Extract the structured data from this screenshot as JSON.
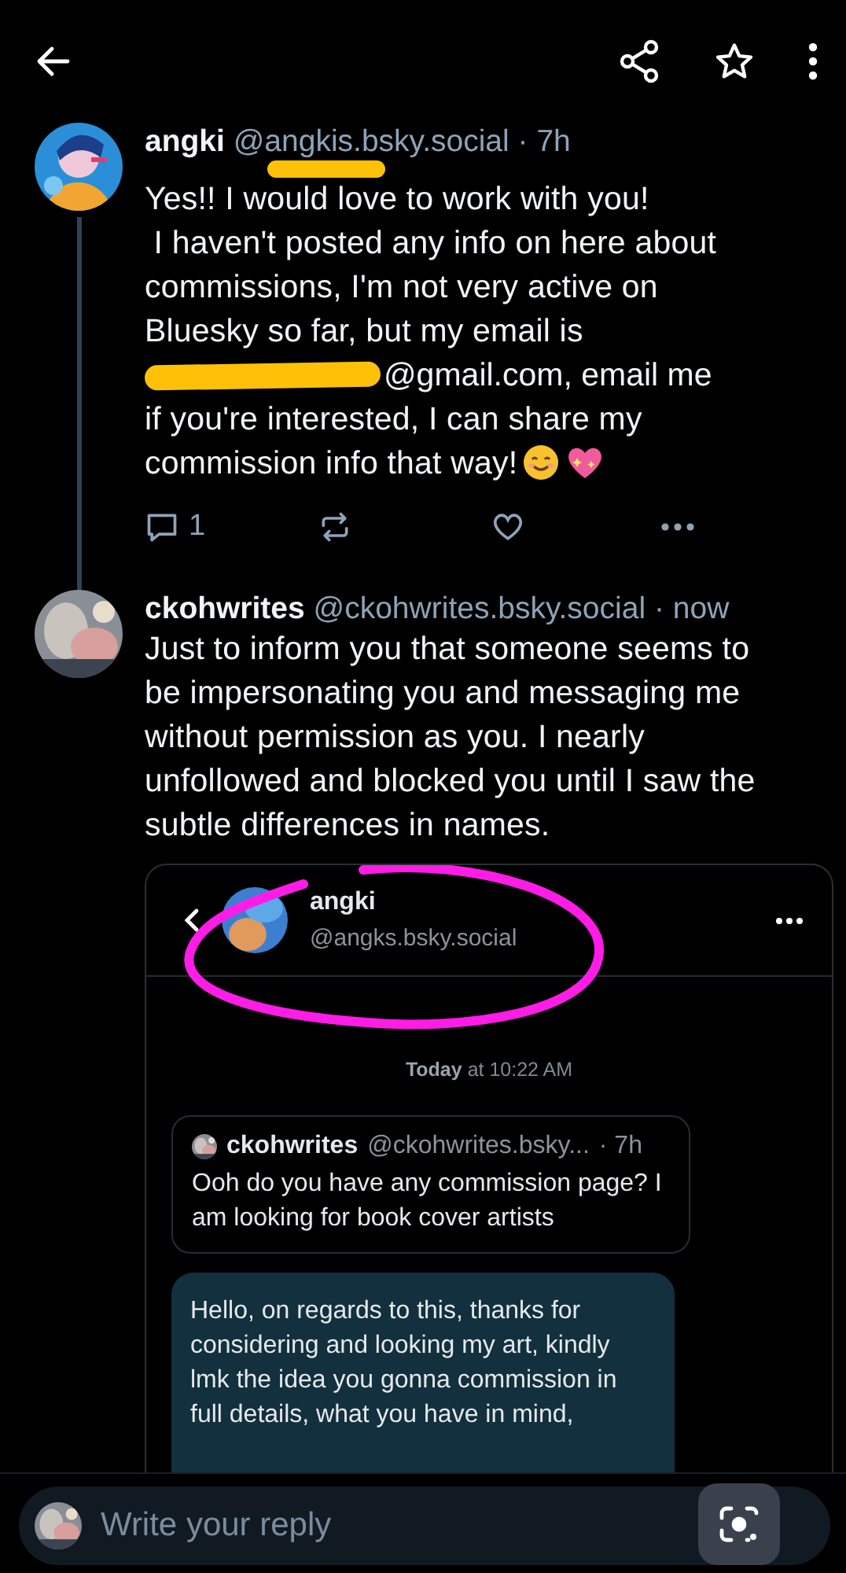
{
  "posts": [
    {
      "name": "angki",
      "handle": "@angkis.bsky.social",
      "time": "· 7h",
      "body": "Yes!! I would love to work with you!\n I haven't posted any info on here about commissions, I'm not very active on Bluesky so far, but my email is",
      "email_line": "@gmail.com, email me",
      "body_end": "if you're interested, I can share my",
      "closing_line": "commission info that way!",
      "replies": "1",
      "thread_line": true,
      "redacted": true
    },
    {
      "name": "ckohwrites",
      "handle": "@ckohwrites.bsky.social",
      "time": "· now",
      "body": "Just to inform you that someone seems to be impersonating you and messaging me without permission as you. I nearly unfollowed and blocked you until I saw the subtle differences in names.",
      "thread_line": false,
      "redacted": false
    }
  ],
  "embedded_screenshot": {
    "name": "angki",
    "handle": "@angks.bsky.social",
    "timestamp": "**Today** at 10:22 AM",
    "quoted": {
      "name": "ckohwrites",
      "handle": "@ckohwrites.bsky...",
      "time": "· 7h",
      "text": "Ooh do you have any commission page? I am looking for book cover artists"
    },
    "message": "Hello, on regards to this, thanks for considering and looking my art, kindly lmk the idea you gonna commission in full details, what you have in mind,"
  },
  "reply": {
    "placeholder": "Write your reply"
  }
}
